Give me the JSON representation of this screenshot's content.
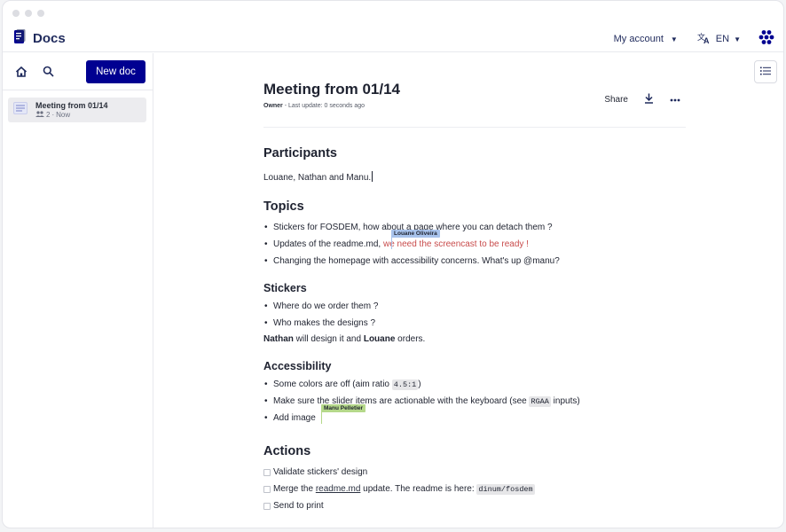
{
  "app": {
    "title": "Docs",
    "colors": {
      "primary": "#000091",
      "accent_red": "#c84b4b",
      "cursor_blue": "#a8c3ec",
      "cursor_green": "#b5d88a"
    }
  },
  "header": {
    "account_label": "My account",
    "language_label": "EN",
    "icons": [
      "docs-logo-icon",
      "translate-icon",
      "gaufre-icon"
    ]
  },
  "sidebar": {
    "new_doc_label": "New doc",
    "documents": [
      {
        "title": "Meeting from 01/14",
        "members": "2",
        "updated": "Now"
      }
    ]
  },
  "document": {
    "title": "Meeting from 01/14",
    "role": "Owner",
    "last_update": "- Last update: 0 seconds ago",
    "share_label": "Share"
  },
  "editor": {
    "participants_heading": "Participants",
    "participants_text": "Louane, Nathan and Manu.",
    "topics_heading": "Topics",
    "topics": {
      "item1": "Stickers for FOSDEM, how about a page where you can detach them ?",
      "item2_prefix": "Updates of the readme.md, ",
      "item2_red": "we need the screencast to be ready !",
      "item3": "Changing the homepage with accessibility concerns. What's up @manu?"
    },
    "stickers_heading": "Stickers",
    "stickers": {
      "item1": "Where do we order them ?",
      "item2": "Who makes the designs ?",
      "summary_name1": "Nathan",
      "summary_mid": " will design it and ",
      "summary_name2": "Louane",
      "summary_end": " orders."
    },
    "accessibility_heading": "Accessibility",
    "accessibility": {
      "item1_prefix": "Some colors are off (aim ratio ",
      "item1_code": "4.5:1",
      "item1_suffix": ")",
      "item2_prefix": "Make sure the slider items are actionable with the keyboard (see ",
      "item2_code": "RGAA",
      "item2_suffix": " inputs)",
      "item3": "Add image"
    },
    "actions_heading": "Actions",
    "actions": {
      "item1": "Validate stickers' design",
      "item2_prefix": "Merge the ",
      "item2_link": "readme.md",
      "item2_mid": " update. The readme is here: ",
      "item2_code": "dinum/fosdem",
      "item3": "Send to print"
    },
    "collaborators": [
      {
        "name": "Louane Oliveira",
        "color": "#a8c3ec"
      },
      {
        "name": "Manu Pelletier",
        "color": "#b5d88a"
      }
    ]
  }
}
